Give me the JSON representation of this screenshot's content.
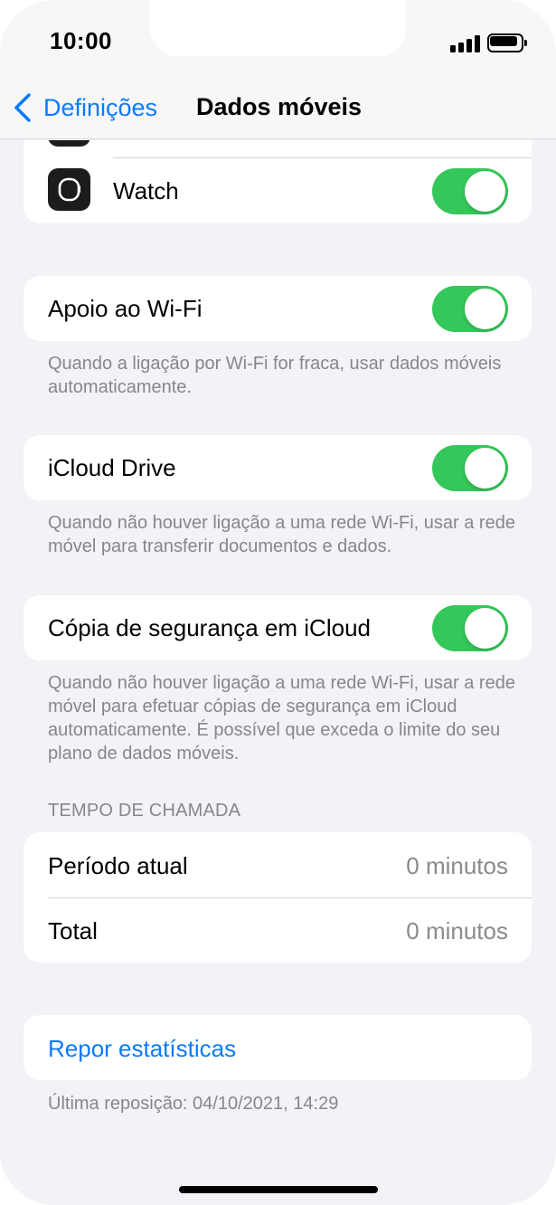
{
  "status_bar": {
    "time": "10:00"
  },
  "nav": {
    "back_label": "Definições",
    "title": "Dados móveis"
  },
  "apps": [
    {
      "label": "Watch",
      "enabled": true
    }
  ],
  "wifi_assist": {
    "label": "Apoio ao Wi-Fi",
    "enabled": true,
    "footer": "Quando a ligação por Wi-Fi for fraca, usar dados móveis automaticamente."
  },
  "icloud_drive": {
    "label": "iCloud Drive",
    "enabled": true,
    "footer": "Quando não houver ligação a uma rede Wi-Fi, usar a rede móvel para transferir documentos e dados."
  },
  "icloud_backup": {
    "label": "Cópia de segurança em iCloud",
    "enabled": true,
    "footer": "Quando não houver ligação a uma rede Wi-Fi, usar a rede móvel para efetuar cópias de segurança em iCloud automaticamente. É possível que exceda o limite do seu plano de dados móveis."
  },
  "call_time": {
    "header": "TEMPO DE CHAMADA",
    "rows": [
      {
        "label": "Período atual",
        "value": "0 minutos"
      },
      {
        "label": "Total",
        "value": "0 minutos"
      }
    ]
  },
  "reset": {
    "label": "Repor estatísticas",
    "footer": "Última reposição: 04/10/2021, 14:29"
  },
  "colors": {
    "accent": "#0a7aff",
    "toggle_on": "#34c759",
    "background": "#f2f2f7"
  }
}
